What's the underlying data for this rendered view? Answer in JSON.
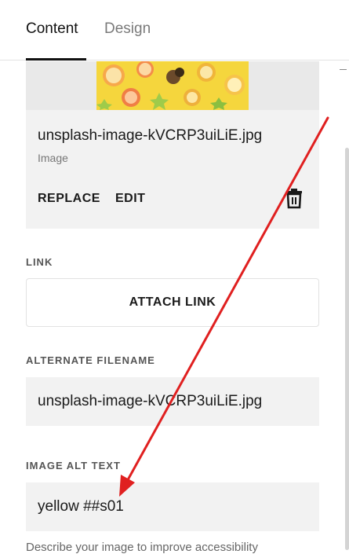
{
  "tabs": [
    {
      "label": "Content",
      "active": true
    },
    {
      "label": "Design",
      "active": false
    }
  ],
  "image_card": {
    "filename": "unsplash-image-kVCRP3uiLiE.jpg",
    "type_label": "Image",
    "replace_label": "REPLACE",
    "edit_label": "EDIT",
    "thumbnail_icon": "fruit-photo"
  },
  "link": {
    "section_label": "LINK",
    "button_label": "ATTACH LINK"
  },
  "alternate_filename": {
    "section_label": "ALTERNATE FILENAME",
    "value": "unsplash-image-kVCRP3uiLiE.jpg"
  },
  "alt_text": {
    "section_label": "IMAGE ALT TEXT",
    "value": "yellow ##s01",
    "helper": "Describe your image to improve accessibility"
  },
  "colors": {
    "annotation_arrow": "#e02020",
    "thumbnail_bg": "#f5d63d"
  }
}
